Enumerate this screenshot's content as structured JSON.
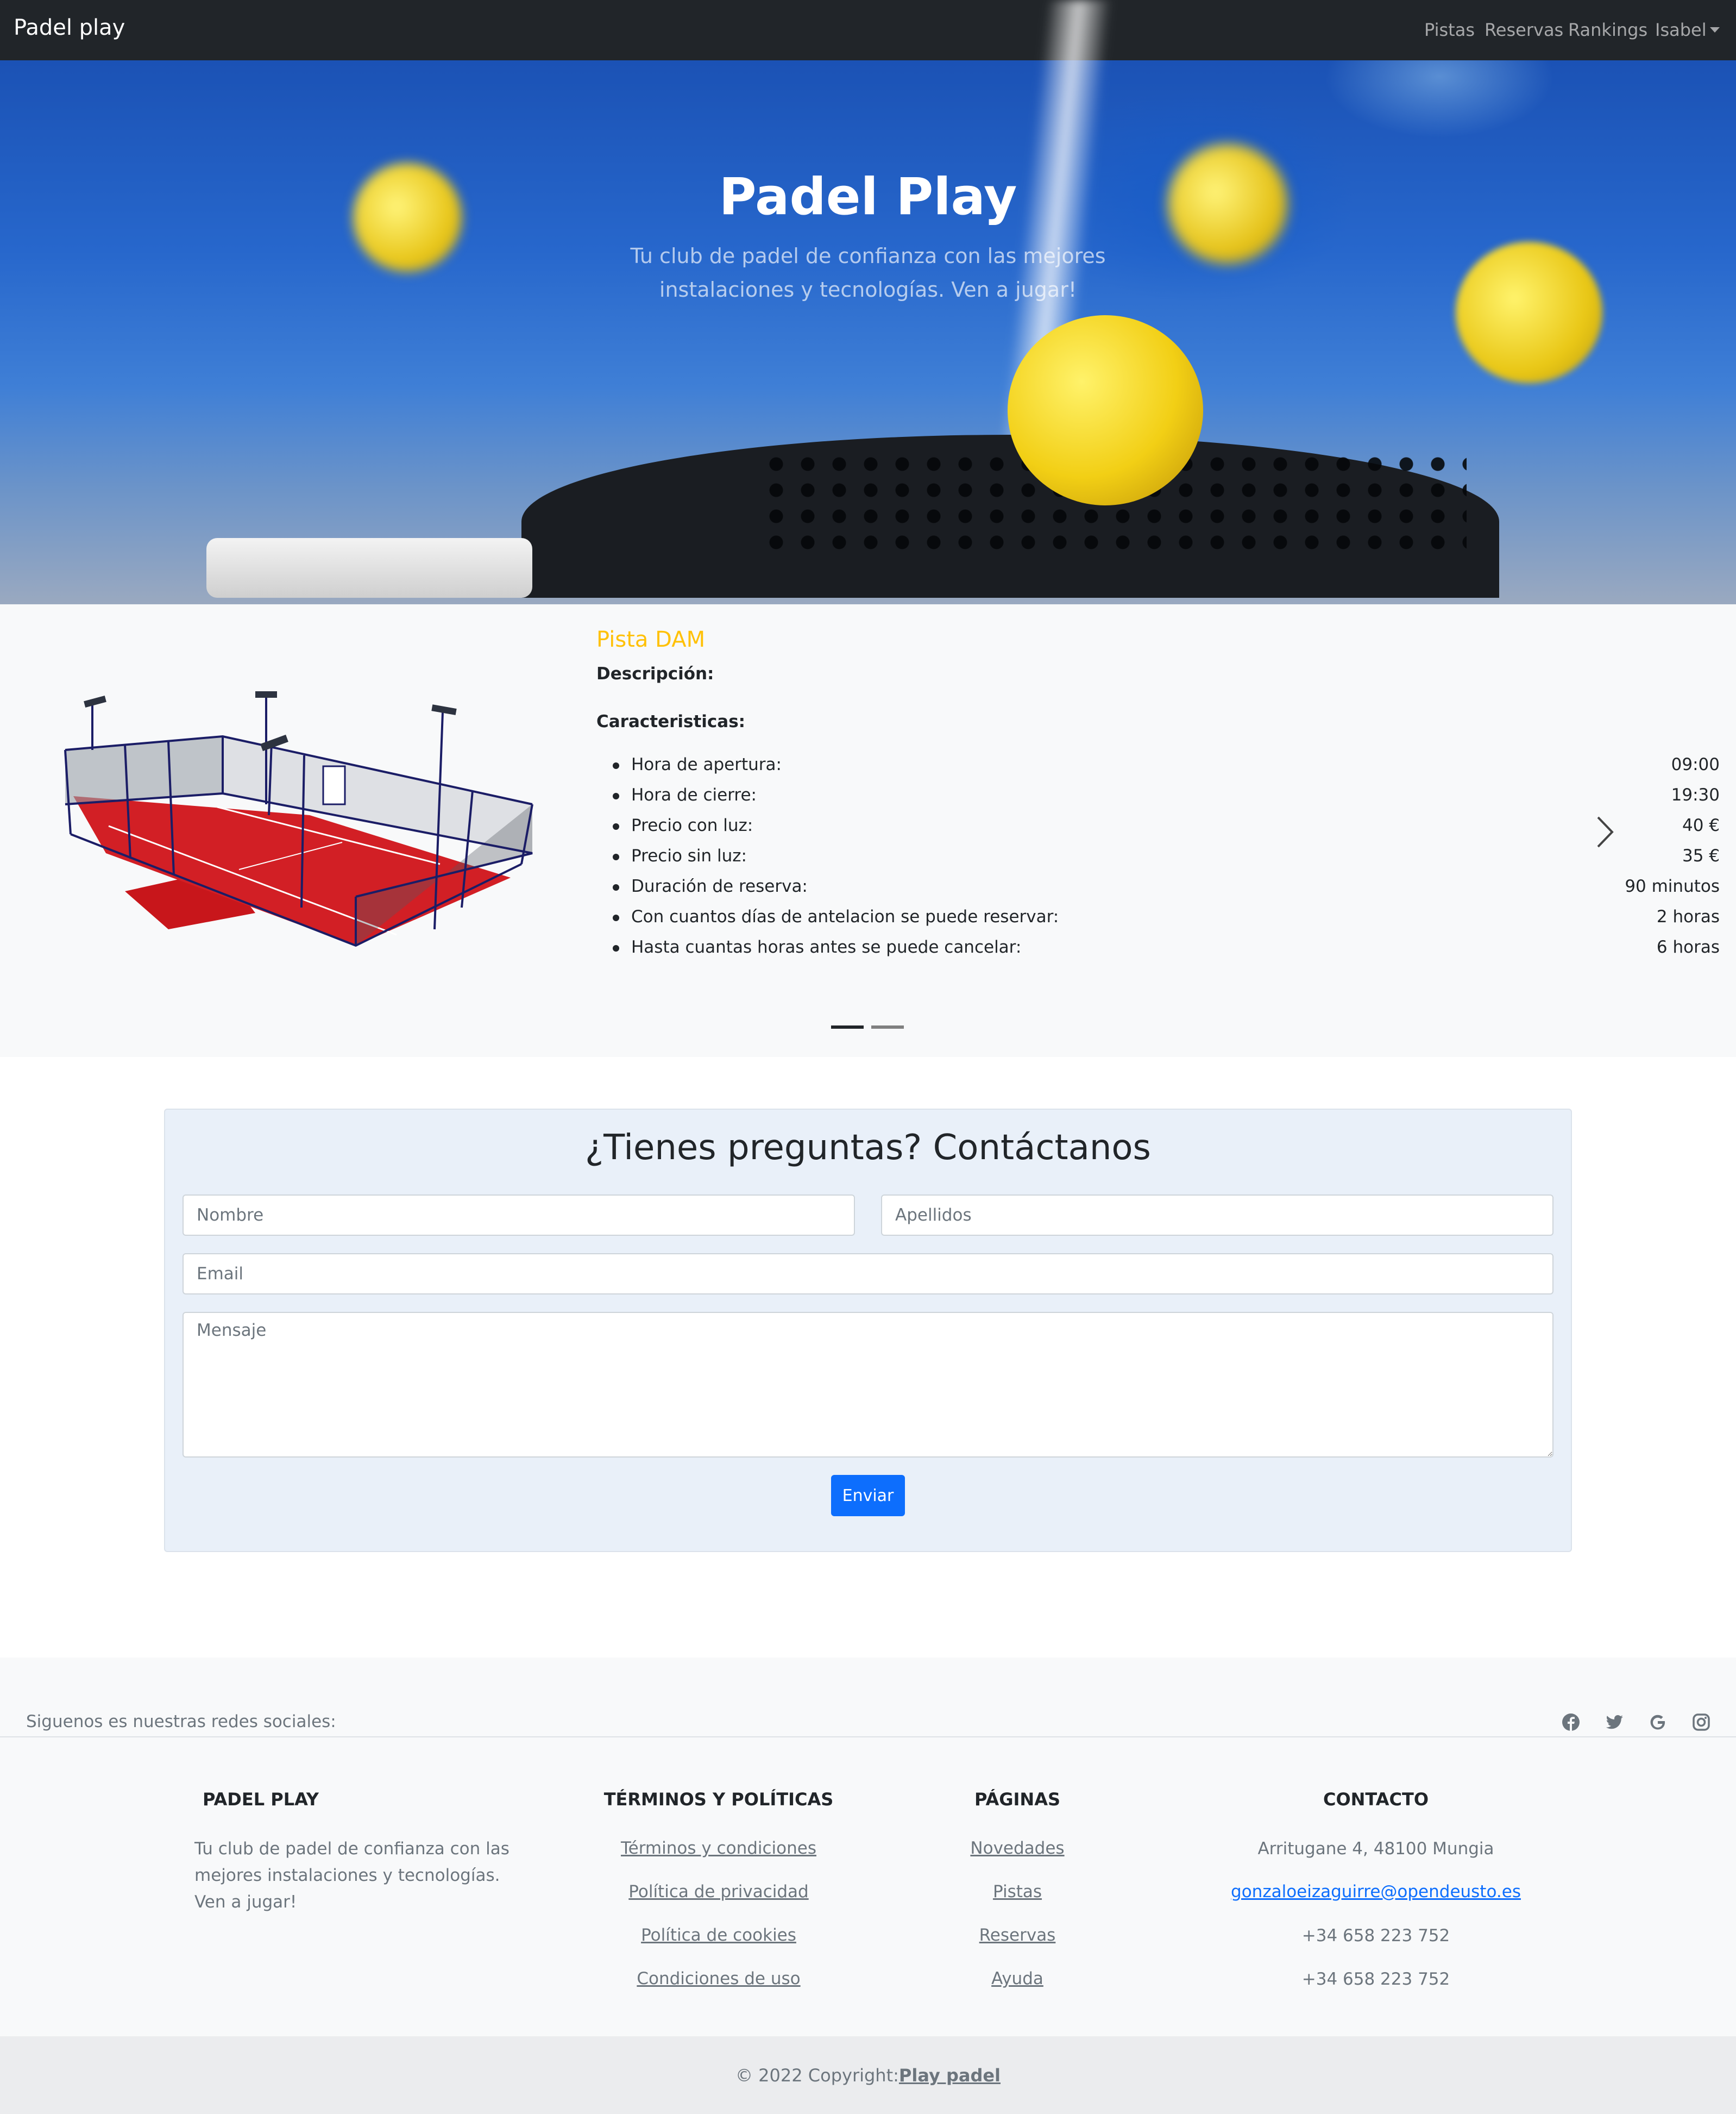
{
  "navbar": {
    "brand": "Padel play",
    "links": [
      "Pistas",
      "Reservas",
      "Rankings"
    ],
    "user": "Isabel"
  },
  "hero": {
    "title": "Padel Play",
    "subtitle": "Tu club de padel de confianza con las mejores instalaciones y tecnologías. Ven a jugar!"
  },
  "carousel": {
    "pista_name": "Pista DAM",
    "description_label": "Descripción:",
    "features_label": "Caracteristicas:",
    "features": [
      {
        "key": "Hora de apertura:",
        "value": "09:00"
      },
      {
        "key": "Hora de cierre:",
        "value": "19:30"
      },
      {
        "key": "Precio con luz:",
        "value": "40 €"
      },
      {
        "key": "Precio sin luz:",
        "value": "35 €"
      },
      {
        "key": "Duración de reserva:",
        "value": "90 minutos"
      },
      {
        "key": "Con cuantos días de antelacion se puede reservar:",
        "value": "2 horas"
      },
      {
        "key": "Hasta cuantas horas antes se puede cancelar:",
        "value": "6 horas"
      }
    ],
    "active_slide": 1,
    "slide_count": 2
  },
  "contact": {
    "title": "¿Tienes preguntas? Contáctanos",
    "nombre_placeholder": "Nombre",
    "apellidos_placeholder": "Apellidos",
    "email_placeholder": "Email",
    "mensaje_placeholder": "Mensaje",
    "submit_label": "Enviar",
    "accent": "#0d6efd"
  },
  "footer": {
    "social_text": "Siguenos es nuestras redes sociales:",
    "social_icons": [
      "facebook-icon",
      "twitter-icon",
      "google-icon",
      "instagram-icon"
    ],
    "brand_title": "PADEL PLAY",
    "brand_text": "Tu club de padel de confianza con las mejores instalaciones y tecnologías. Ven a jugar!",
    "terms_title": "TÉRMINOS Y POLÍTICAS",
    "terms_links": [
      "Términos y condiciones",
      "Política de privacidad",
      "Política de cookies",
      "Condiciones de uso"
    ],
    "pages_title": "PÁGINAS",
    "pages_links": [
      "Novedades",
      "Pistas",
      "Reservas",
      "Ayuda"
    ],
    "contact_title": "CONTACTO",
    "address": "Arritugane 4, 48100 Mungia",
    "email": "gonzaloeizaguirre@opendeusto.es",
    "phones": [
      "+34 658 223 752",
      "+34 658 223 752"
    ],
    "copyright_prefix": "© 2022 Copyright:",
    "copyright_link": "Play padel"
  }
}
